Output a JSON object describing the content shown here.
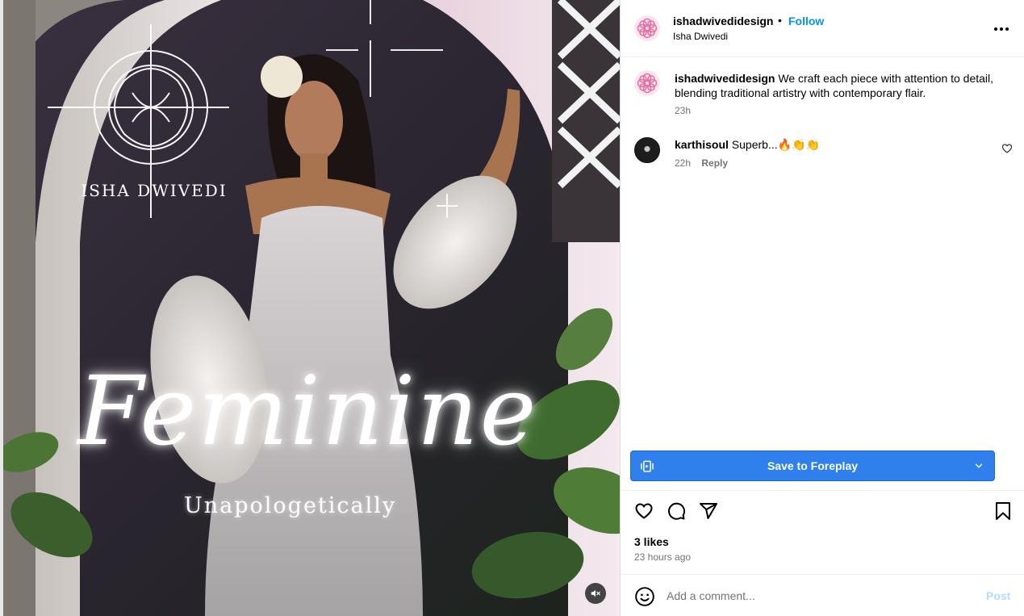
{
  "media": {
    "brand_text": "ISHA DWIVEDI",
    "title_text": "Feminine",
    "subtitle_text": "Unapologetically",
    "muted": true
  },
  "post_header": {
    "username": "ishadwivedidesign",
    "separator": "•",
    "follow_label": "Follow",
    "subtitle": "Isha Dwivedi"
  },
  "caption": {
    "username": "ishadwivedidesign",
    "text": "We craft each piece with attention to detail, blending traditional artistry with contemporary flair.",
    "time": "23h"
  },
  "comments": [
    {
      "username": "karthisoul",
      "text": "Superb...🔥👏👏",
      "time": "22h",
      "reply_label": "Reply"
    }
  ],
  "save_bar": {
    "label": "Save to Foreplay",
    "color": "#2f80ed"
  },
  "actions": {
    "icons": [
      "heart-icon",
      "comment-icon",
      "share-icon",
      "bookmark-icon"
    ]
  },
  "likes_text": "3 likes",
  "posted_text": "23 hours ago",
  "add_comment": {
    "placeholder": "Add a comment...",
    "post_label": "Post"
  },
  "colors": {
    "link": "#0095f6",
    "secondary_text": "#737373",
    "post_disabled": "#b3dbff"
  }
}
